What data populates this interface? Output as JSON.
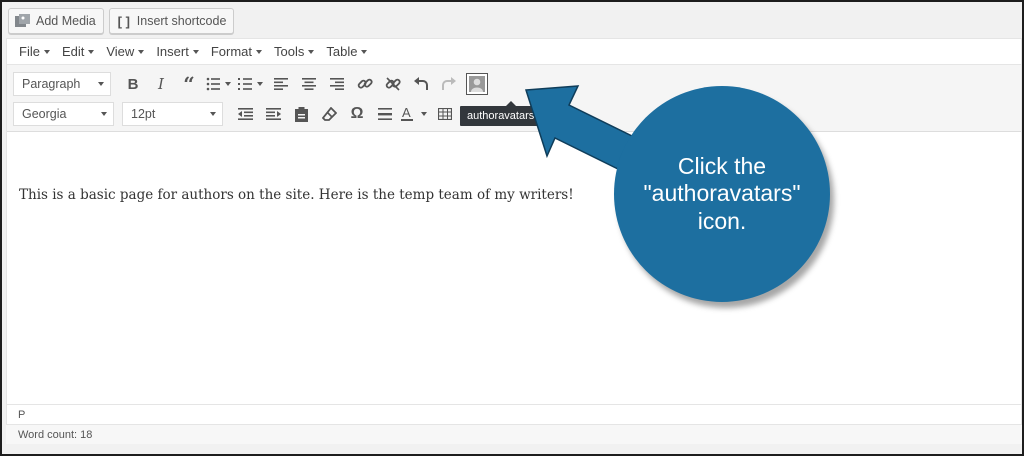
{
  "media_buttons": {
    "add_media": "Add Media",
    "insert_shortcode": "Insert shortcode"
  },
  "menubar": [
    {
      "label": "File"
    },
    {
      "label": "Edit"
    },
    {
      "label": "View"
    },
    {
      "label": "Insert"
    },
    {
      "label": "Format"
    },
    {
      "label": "Tools"
    },
    {
      "label": "Table"
    }
  ],
  "toolbar": {
    "format_select": "Paragraph",
    "font_select": "Georgia",
    "size_select": "12pt",
    "tooltip": "authoravatars"
  },
  "editor": {
    "content": "This is a basic page for authors on the site. Here is the temp team of my writers!",
    "path": "P",
    "word_count": "Word count: 18"
  },
  "annotation": {
    "text": "Click the \"authoravatars\" icon.",
    "color": "#1d6fa0"
  }
}
